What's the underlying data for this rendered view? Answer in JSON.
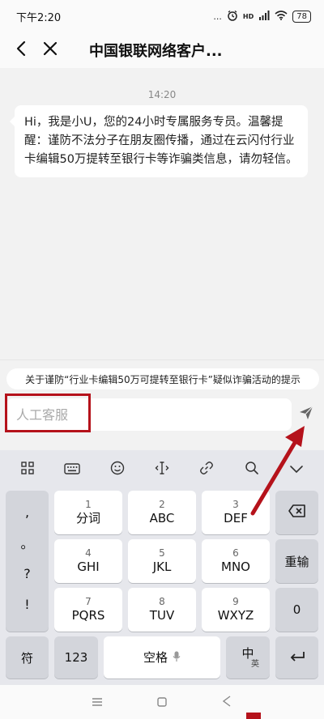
{
  "status_bar": {
    "time": "下午2:20",
    "signal_text": "...",
    "hd_text": "HD",
    "battery": "78"
  },
  "nav": {
    "title": "中国银联网络客户..."
  },
  "chat": {
    "time": "14:20",
    "message": "Hi，我是小U，您的24小时专属服务专员。温馨提醒：谨防不法分子在朋友圈传播，通过在云闪付行业卡编辑50万提转至银行卡等诈骗类信息，请勿轻信。"
  },
  "notice": {
    "text": "关于谨防“行业卡编辑50万可提转至银行卡”疑似诈骗活动的提示"
  },
  "input": {
    "placeholder": "人工客服"
  },
  "keyboard": {
    "punctuation": [
      ",",
      "。",
      "?",
      "!"
    ],
    "keys": [
      {
        "num": "1",
        "label": "分词"
      },
      {
        "num": "2",
        "label": "ABC"
      },
      {
        "num": "3",
        "label": "DEF"
      },
      {
        "num": "4",
        "label": "GHI"
      },
      {
        "num": "5",
        "label": "JKL"
      },
      {
        "num": "6",
        "label": "MNO"
      },
      {
        "num": "7",
        "label": "PQRS"
      },
      {
        "num": "8",
        "label": "TUV"
      },
      {
        "num": "9",
        "label": "WXYZ"
      }
    ],
    "reenter": "重输",
    "zero": "0",
    "symbol": "符",
    "numbers": "123",
    "space": "空格",
    "lang_main": "中",
    "lang_sub": "英"
  },
  "colors": {
    "highlight": "#b5121b",
    "accent": "#b5121b"
  }
}
